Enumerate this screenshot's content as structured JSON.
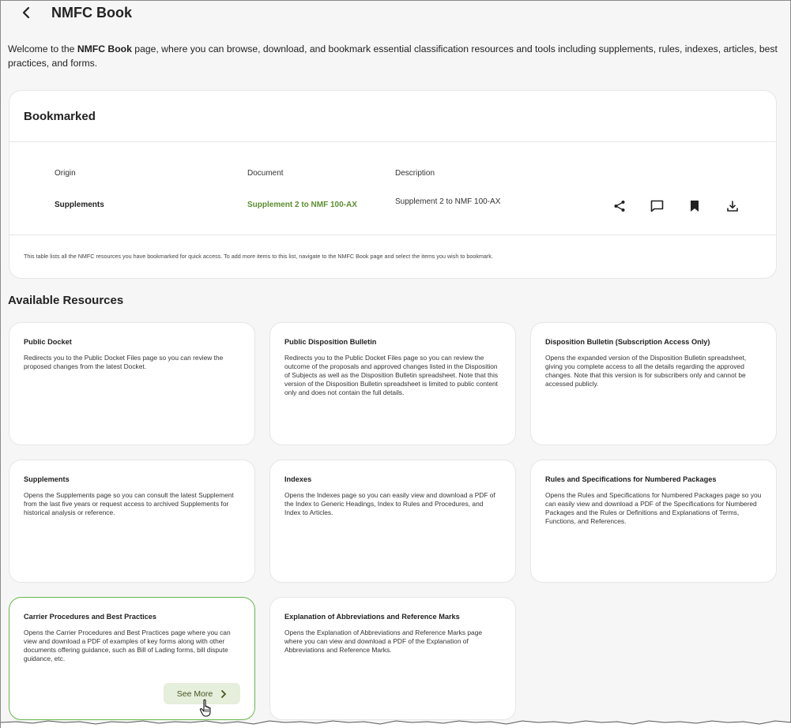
{
  "header": {
    "title": "NMFC Book"
  },
  "intro": {
    "prefix": "Welcome to the ",
    "bold": "NMFC Book",
    "suffix": " page, where you can browse, download, and bookmark essential classification resources and tools including supplements, rules, indexes, articles, best practices, and forms."
  },
  "bookmarked": {
    "title": "Bookmarked",
    "columns": {
      "origin": "Origin",
      "document": "Document",
      "description": "Description"
    },
    "row": {
      "origin": "Supplements",
      "document": "Supplement 2 to NMF 100-AX",
      "description": "Supplement 2 to NMF 100-AX"
    },
    "actions": [
      "share-icon",
      "comment-icon",
      "bookmark-icon",
      "download-icon"
    ],
    "footnote": "This table lists all the NMFC resources you have bookmarked for quick access. To add more items to this list, navigate to the NMFC Book page and select the items you wish to bookmark."
  },
  "available": {
    "title": "Available Resources",
    "cards": [
      {
        "title": "Public Docket",
        "description": "Redirects you to the Public Docket Files page so you can review the proposed changes from the latest Docket."
      },
      {
        "title": "Public Disposition Bulletin",
        "description": "Redirects you to the Public Docket Files page so you can review the outcome of the proposals and approved changes listed in the Disposition of Subjects as well as the Disposition Bulletin spreadsheet. Note that this version of the Disposition Bulletin spreadsheet is limited to public content only and does not contain the full details."
      },
      {
        "title": "Disposition Bulletin (Subscription Access Only)",
        "description": "Opens the expanded version of the Disposition Bulletin spreadsheet, giving you complete access to all the details regarding the approved changes. Note that this version is for subscribers only and cannot be accessed publicly."
      },
      {
        "title": "Supplements",
        "description": "Opens the Supplements page so you can consult the latest Supplement from the last five years or request access to archived Supplements for historical analysis or reference."
      },
      {
        "title": "Indexes",
        "description": "Opens the Indexes page so you can easily view and download a PDF of the Index to Generic Headings, Index to Rules and Procedures, and Index to Articles."
      },
      {
        "title": "Rules and Specifications for Numbered Packages",
        "description": "Opens the Rules and Specifications for Numbered Packages page so you can easily view and download a PDF of the Specifications for Numbered Packages and the Rules or Definitions and Explanations of Terms, Functions, and References."
      },
      {
        "title": "Carrier Procedures and Best Practices",
        "description": "Opens the Carrier Procedures and Best Practices page where you can view and download a PDF of examples of key forms along with other documents offering guidance, such as Bill of Lading forms, bill dispute guidance, etc.",
        "button": "See More"
      },
      {
        "title": "Explanation of Abbreviations and Reference Marks",
        "description": "Opens the Explanation of Abbreviations and Reference Marks page where you can view and download a PDF of the Explanation of Abbreviations and Reference Marks."
      }
    ]
  },
  "colors": {
    "accent_green": "#5b8e2e",
    "active_border": "#66b84a",
    "button_bg": "#e6eedc"
  }
}
